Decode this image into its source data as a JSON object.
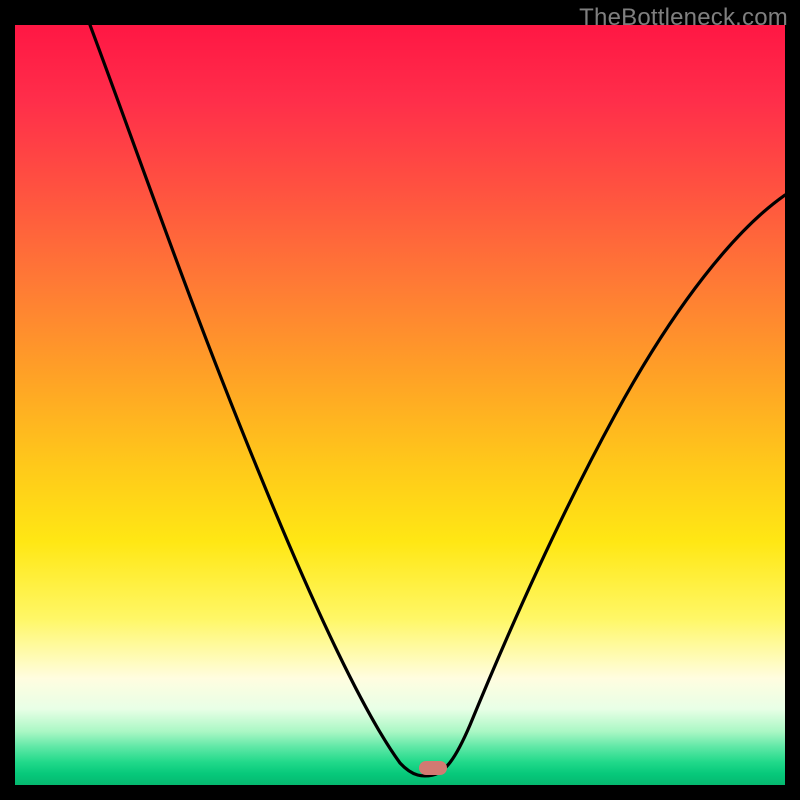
{
  "watermark": "TheBottleneck.com",
  "chart_data": {
    "type": "line",
    "title": "",
    "xlabel": "",
    "ylabel": "",
    "xlim": [
      0,
      100
    ],
    "ylim": [
      0,
      100
    ],
    "x": [
      0,
      5,
      10,
      15,
      20,
      25,
      30,
      35,
      40,
      45,
      48,
      50,
      52,
      55,
      57,
      60,
      65,
      70,
      75,
      80,
      85,
      90,
      95,
      100
    ],
    "values": [
      100,
      92,
      84,
      76,
      67,
      58,
      49,
      40,
      30,
      18,
      8,
      2,
      0,
      0,
      3,
      10,
      24,
      36,
      46,
      55,
      62,
      67,
      71,
      75
    ],
    "marker": {
      "x": 54,
      "y": 0
    },
    "gradient_stops": [
      {
        "pos": 0.0,
        "color": "#ff1744"
      },
      {
        "pos": 0.22,
        "color": "#ff5340"
      },
      {
        "pos": 0.46,
        "color": "#ffa126"
      },
      {
        "pos": 0.68,
        "color": "#ffe714"
      },
      {
        "pos": 0.86,
        "color": "#fffde0"
      },
      {
        "pos": 0.95,
        "color": "#5fe8a6"
      },
      {
        "pos": 1.0,
        "color": "#05b86f"
      }
    ]
  }
}
